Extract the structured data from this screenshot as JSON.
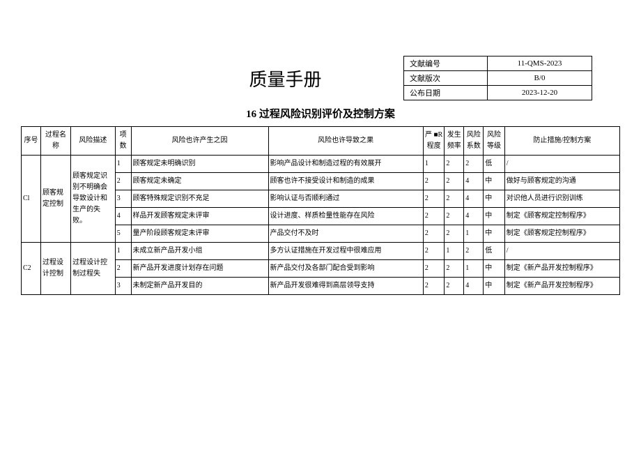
{
  "header": {
    "title": "质量手册",
    "meta": {
      "doc_no_label": "文献编号",
      "doc_no_value": "11-QMS-2023",
      "version_label": "文献版次",
      "version_value": "B/0",
      "date_label": "公布日期",
      "date_value": "2023-12-20"
    }
  },
  "section_title": "16 过程风险识别评价及控制方案",
  "columns": {
    "seq": "序号",
    "proc": "过程名称",
    "desc": "风险描述",
    "item": "项数",
    "cause": "风险也许产生之因",
    "effect": "风险也许导致之果",
    "sev": "严 ■R 程度",
    "freq": "发生频率",
    "coef": "风险系数",
    "level": "风险等级",
    "action": "防止措施/控制方案"
  },
  "groups": [
    {
      "seq": "Cl",
      "proc": "顾客规定控制",
      "desc": "顾客规定识别不明确会导致设计和生产的失败。",
      "rows": [
        {
          "item": "1",
          "cause": "顾客规定未明确识别",
          "effect": "影响产品设计和制造过程的有效展开",
          "sev": "1",
          "freq": "2",
          "coef": "2",
          "level": "低",
          "action": "/"
        },
        {
          "item": "2",
          "cause": "顾客规定未确定",
          "effect": "顾客也许不接受设计和制造的成果",
          "sev": "2",
          "freq": "2",
          "coef": "4",
          "level": "中",
          "action": "做好与顾客规定的沟通"
        },
        {
          "item": "3",
          "cause": "顾客特殊规定识别不充足",
          "effect": "影响认证与否顺利通过",
          "sev": "2",
          "freq": "2",
          "coef": "4",
          "level": "中",
          "action": "对识他人员进行识别训练"
        },
        {
          "item": "4",
          "cause": "样品开发顾客规定未评审",
          "effect": "设计进度、样质检量性能存在风险",
          "sev": "2",
          "freq": "2",
          "coef": "4",
          "level": "中",
          "action": "制定《顾客规定控制程序》"
        },
        {
          "item": "5",
          "cause": "量产阶段顾客规定未评审",
          "effect": "产品交付不及时",
          "sev": "2",
          "freq": "2",
          "coef": "1",
          "level": "中",
          "action": "制定《顾客规定控制程序》"
        }
      ]
    },
    {
      "seq": "C2",
      "proc": "过程设计控制",
      "desc": "过程设计控制过程失",
      "rows": [
        {
          "item": "1",
          "cause": "未成立新产品开发小组",
          "effect": "多方认证措施在开发过程中很难应用",
          "sev": "2",
          "freq": "1",
          "coef": "2",
          "level": "低",
          "action": "/"
        },
        {
          "item": "2",
          "cause": "新产品开发进度计划存在问题",
          "effect": "新产品交付及各部门配合受到影响",
          "sev": "2",
          "freq": "2",
          "coef": "1",
          "level": "中",
          "action": "制定《新产品开发控制程序》"
        },
        {
          "item": "3",
          "cause": "未制定新产品开发目的",
          "effect": "新产品开发很难得到高层领导支持",
          "sev": "2",
          "freq": "2",
          "coef": "4",
          "level": "中",
          "action": "制定《新产品开发控制程序》"
        }
      ]
    }
  ]
}
